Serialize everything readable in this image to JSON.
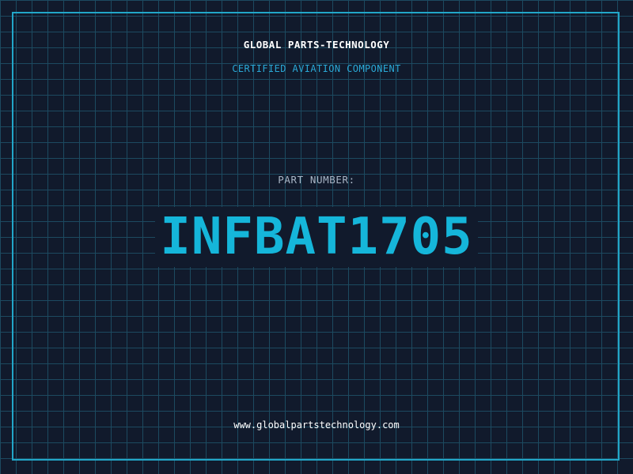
{
  "header": {
    "company_name": "GLOBAL PARTS-TECHNOLOGY",
    "tagline": "CERTIFIED AVIATION COMPONENT"
  },
  "part": {
    "label": "PART NUMBER:",
    "number": "INFBAT1705"
  },
  "footer": {
    "website": "www.globalpartstechnology.com"
  },
  "colors": {
    "background": "#111a2c",
    "grid_line": "#1c4a60",
    "frame_border": "#22a6c8",
    "accent": "#15b6da",
    "tagline": "#2aa8d6",
    "label": "#a9b6c6",
    "text": "#ffffff"
  }
}
